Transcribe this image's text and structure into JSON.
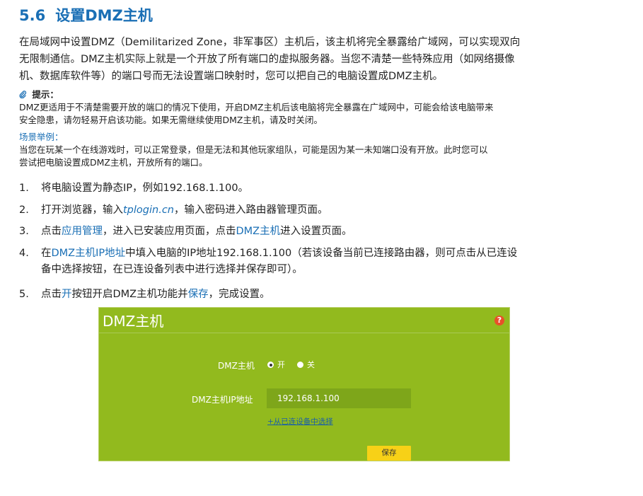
{
  "heading": {
    "number": "5.6",
    "title": "设置DMZ主机"
  },
  "intro": {
    "line1": "在局域网中设置DMZ（Demilitarized Zone，非军事区）主机后，该主机将完全暴露给广域网，可以实现双向",
    "line2": "无限制通信。DMZ主机实际上就是一个开放了所有端口的虚拟服务器。当您不清楚一些特殊应用（如网络摄像",
    "line3": "机、数据库软件等）的端口号而无法设置端口映射时，您可以把自己的电脑设置成DMZ主机。"
  },
  "tip": {
    "title": "提示：",
    "line1": "DMZ更适用于不清楚需要开放的端口的情况下使用，开启DMZ主机后该电脑将完全暴露在广域网中，可能会给该电脑带来",
    "line2": "安全隐患，请勿轻易开启该功能。如果无需继续使用DMZ主机，请及时关闭。"
  },
  "scenario": {
    "title": "场景举例：",
    "line1": "当您在玩某一个在线游戏时，可以正常登录，但是无法和其他玩家组队，可能是因为某一未知端口没有开放。此时您可以",
    "line2": "尝试把电脑设置成DMZ主机，开放所有的端口。"
  },
  "steps": [
    {
      "num": "1.",
      "text": "将电脑设置为静态IP，例如192.168.1.100。"
    },
    {
      "num": "2.",
      "pre": "打开浏览器，输入",
      "link": "tplogin.cn",
      "post": "，输入密码进入路由器管理页面。"
    },
    {
      "num": "3.",
      "pre": "点击",
      "link1": "应用管理",
      "mid": "，进入已安装应用页面，点击",
      "link2": "DMZ主机",
      "post": "进入设置页面。"
    },
    {
      "num": "4.",
      "pre": "在",
      "link": "DMZ主机IP地址",
      "post": "中填入电脑的IP地址192.168.1.100（若该设备当前已连接路由器，则可点击从已连设",
      "line2": "备中选择按钮，在已连设备列表中进行选择并保存即可）。"
    },
    {
      "num": "5.",
      "pre": "点击",
      "link1": "开",
      "mid": "按钮开启DMZ主机功能并",
      "link2": "保存",
      "post": "，完成设置。"
    }
  ],
  "panel": {
    "title": "DMZ主机",
    "help": "?",
    "dmz_label": "DMZ主机",
    "radio_on_label": "开",
    "radio_off_label": "关",
    "radio_selected": "开",
    "ip_label": "DMZ主机IP地址",
    "ip_value": "192.168.1.100",
    "select_link": "+从已连设备中选择",
    "save_label": "保存",
    "colors": {
      "background": "#92ba1e",
      "save_button": "#f7d117",
      "help_icon": "#e8502a"
    }
  }
}
